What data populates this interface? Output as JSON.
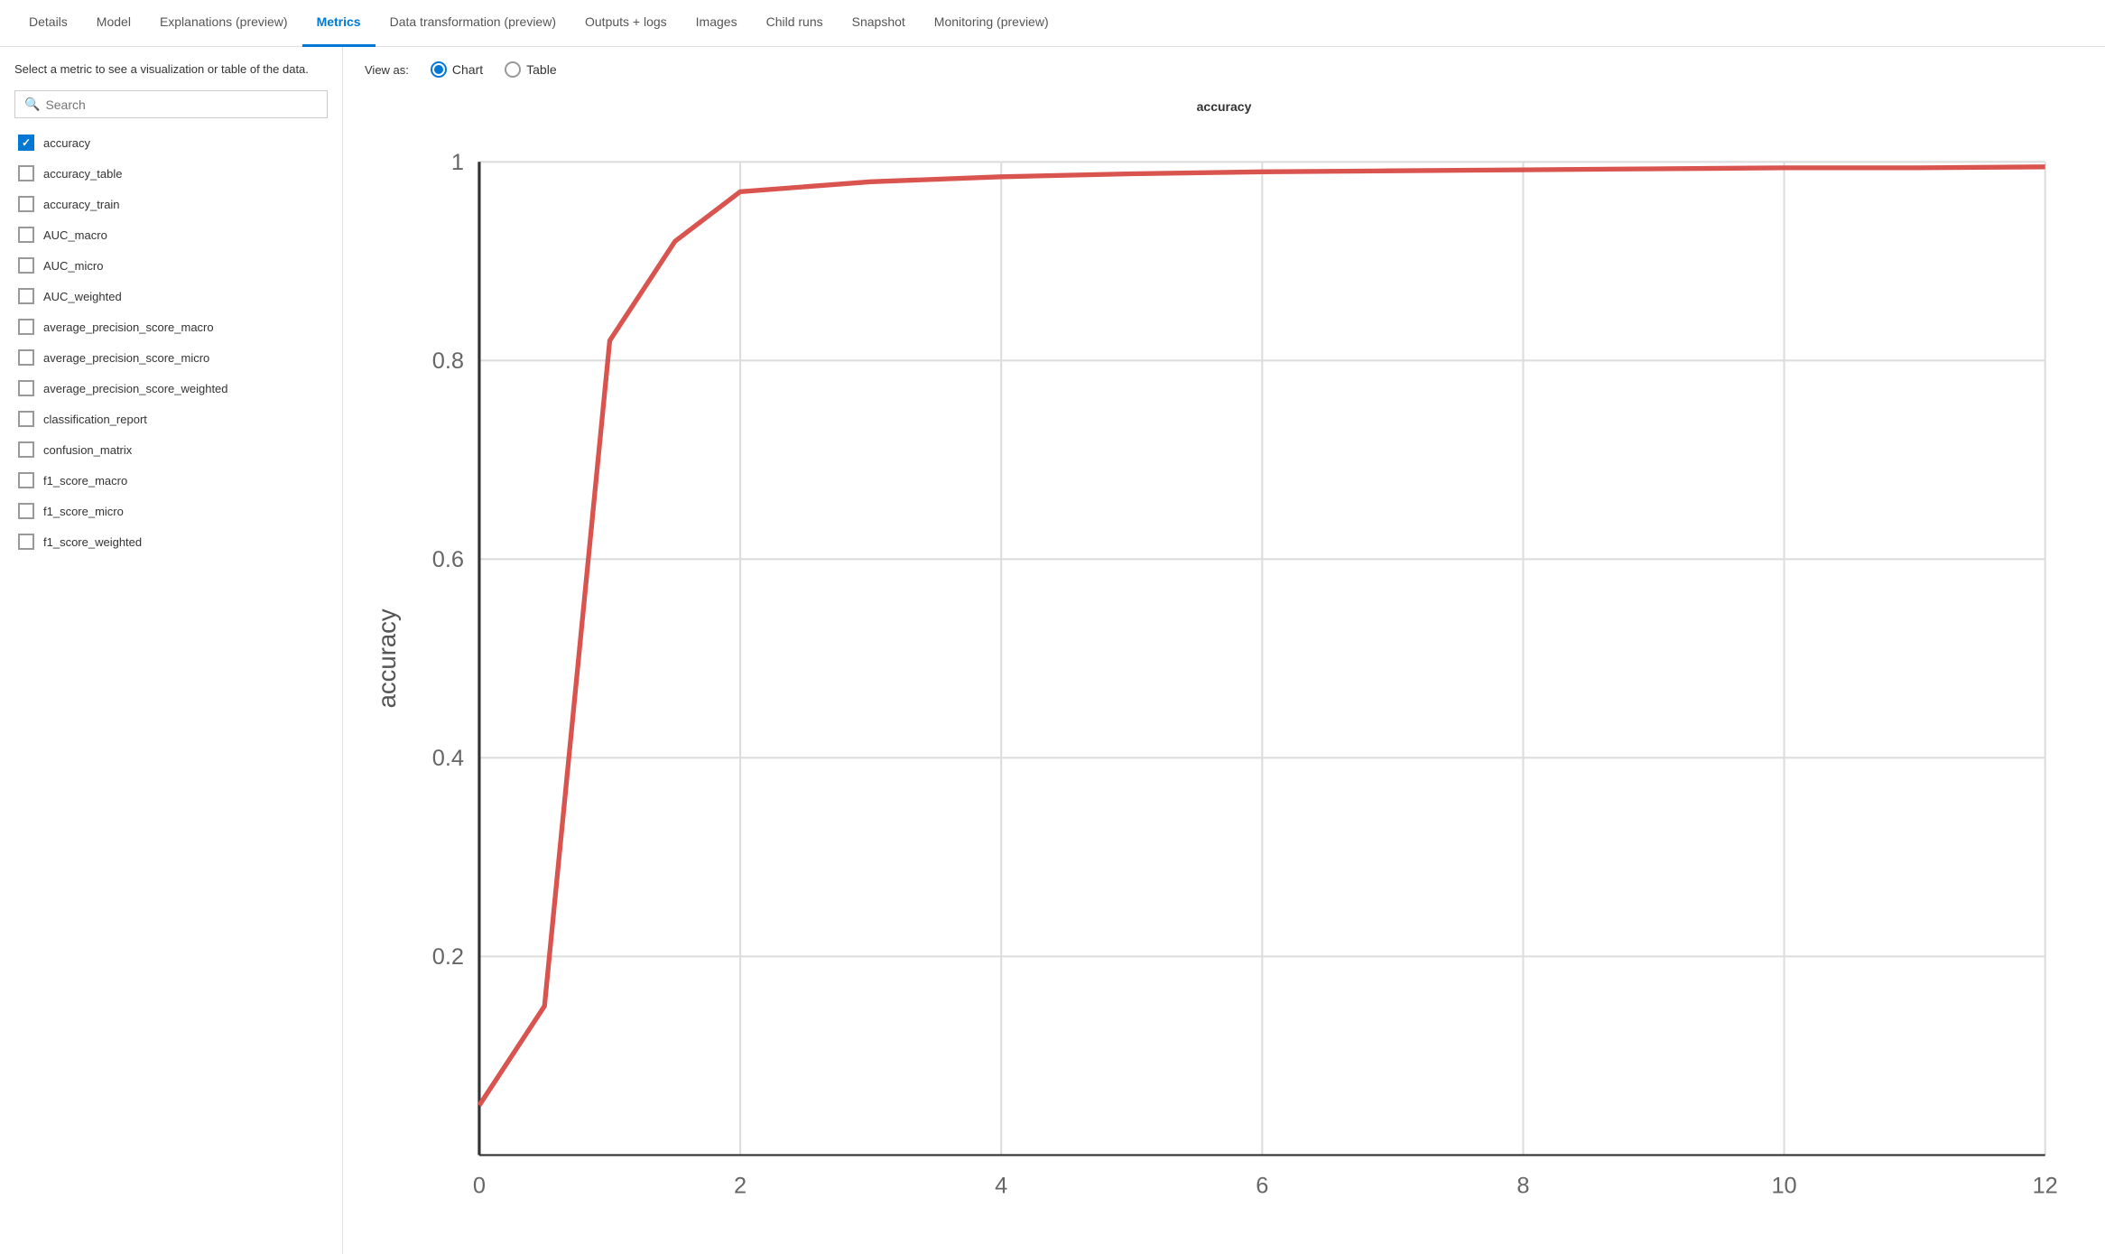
{
  "nav": {
    "tabs": [
      {
        "label": "Details",
        "active": false
      },
      {
        "label": "Model",
        "active": false
      },
      {
        "label": "Explanations (preview)",
        "active": false
      },
      {
        "label": "Metrics",
        "active": true
      },
      {
        "label": "Data transformation (preview)",
        "active": false
      },
      {
        "label": "Outputs + logs",
        "active": false
      },
      {
        "label": "Images",
        "active": false
      },
      {
        "label": "Child runs",
        "active": false
      },
      {
        "label": "Snapshot",
        "active": false
      },
      {
        "label": "Monitoring (preview)",
        "active": false
      }
    ]
  },
  "sidebar": {
    "description": "Select a metric to see a visualization or table of the data.",
    "search_placeholder": "Search",
    "metrics": [
      {
        "label": "accuracy",
        "checked": true
      },
      {
        "label": "accuracy_table",
        "checked": false
      },
      {
        "label": "accuracy_train",
        "checked": false
      },
      {
        "label": "AUC_macro",
        "checked": false
      },
      {
        "label": "AUC_micro",
        "checked": false
      },
      {
        "label": "AUC_weighted",
        "checked": false
      },
      {
        "label": "average_precision_score_macro",
        "checked": false
      },
      {
        "label": "average_precision_score_micro",
        "checked": false
      },
      {
        "label": "average_precision_score_weighted",
        "checked": false
      },
      {
        "label": "classification_report",
        "checked": false
      },
      {
        "label": "confusion_matrix",
        "checked": false
      },
      {
        "label": "f1_score_macro",
        "checked": false
      },
      {
        "label": "f1_score_micro",
        "checked": false
      },
      {
        "label": "f1_score_weighted",
        "checked": false
      }
    ]
  },
  "view_toggle": {
    "label": "View as:",
    "options": [
      {
        "label": "Chart",
        "selected": true
      },
      {
        "label": "Table",
        "selected": false
      }
    ]
  },
  "chart": {
    "title": "accuracy",
    "y_axis_label": "accuracy",
    "x_ticks": [
      "0",
      "2",
      "4",
      "6",
      "8",
      "10",
      "12"
    ],
    "y_ticks": [
      "0.2",
      "0.4",
      "0.6",
      "0.8",
      "1"
    ],
    "line_color": "#d9534f",
    "data_points": [
      {
        "x": 0,
        "y": 0.05
      },
      {
        "x": 0.5,
        "y": 0.15
      },
      {
        "x": 1,
        "y": 0.82
      },
      {
        "x": 1.5,
        "y": 0.92
      },
      {
        "x": 2,
        "y": 0.97
      },
      {
        "x": 3,
        "y": 0.98
      },
      {
        "x": 4,
        "y": 0.985
      },
      {
        "x": 5,
        "y": 0.988
      },
      {
        "x": 6,
        "y": 0.99
      },
      {
        "x": 7,
        "y": 0.991
      },
      {
        "x": 8,
        "y": 0.992
      },
      {
        "x": 9,
        "y": 0.993
      },
      {
        "x": 10,
        "y": 0.994
      },
      {
        "x": 11,
        "y": 0.994
      },
      {
        "x": 12,
        "y": 0.995
      }
    ]
  }
}
